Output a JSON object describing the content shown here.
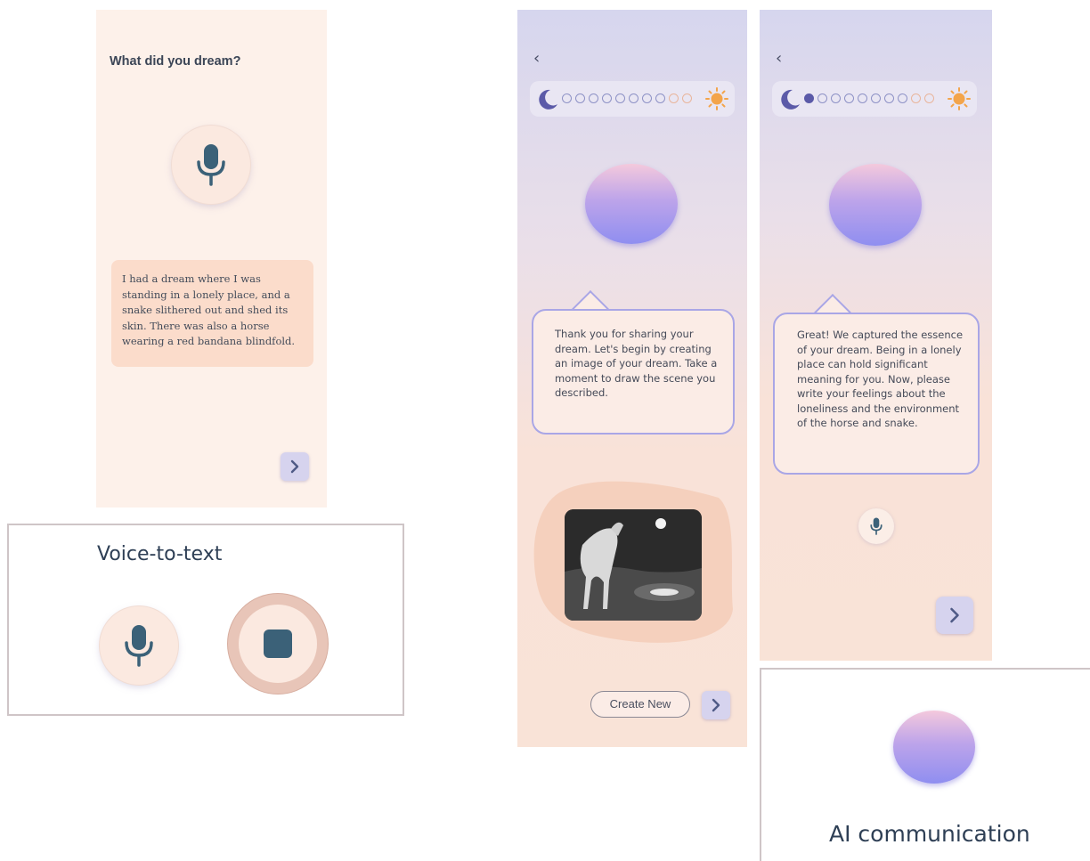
{
  "screen1": {
    "question": "What did you dream?",
    "dream_text": "I had a dream where I was standing in a lonely place, and a snake slithered out and shed its skin. There was also a horse wearing a red bandana blindfold.",
    "mic_icon": "microphone-icon",
    "next_icon": "chevron-right-icon"
  },
  "voice_panel": {
    "title": "Voice-to-text",
    "mic_icon": "microphone-icon",
    "stop_icon": "stop-icon"
  },
  "screen2": {
    "back_label": "‹",
    "progress": {
      "filled": 0,
      "total": 10
    },
    "message": "Thank you for sharing your dream. Let's begin by creating an image of your dream. Take a moment to draw the scene you described.",
    "create_button": "Create New",
    "next_icon": "chevron-right-icon"
  },
  "screen3": {
    "back_label": "‹",
    "progress": {
      "filled": 1,
      "total": 10
    },
    "message": "Great! We captured the essence of your dream. Being in a lonely place can hold significant meaning for you. Now, please write your feelings about the loneliness and the environment of the horse and snake.",
    "mic_icon": "microphone-icon",
    "next_icon": "chevron-right-icon"
  },
  "ai_panel": {
    "title": "AI communication"
  },
  "colors": {
    "accent_dark": "#3b6178",
    "orb_top": "#f4c9dc",
    "orb_bottom": "#8f8ef0",
    "bubble_border": "#a9a6e6",
    "sun": "#f3a44a",
    "moon": "#5b5aa8"
  }
}
